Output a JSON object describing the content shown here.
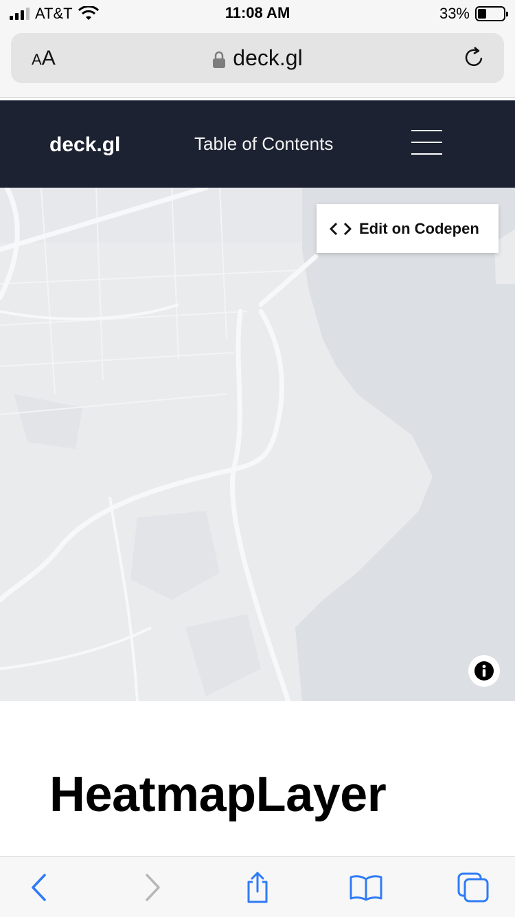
{
  "status_bar": {
    "carrier": "AT&T",
    "time": "11:08 AM",
    "battery": "33%",
    "battery_level": 0.33
  },
  "browser": {
    "text_size_label_small": "A",
    "text_size_label_large": "A",
    "url": "deck.gl"
  },
  "site_header": {
    "logo": "deck.gl",
    "toc_label": "Table of Contents"
  },
  "map": {
    "codepen_label": "Edit on Codepen"
  },
  "page": {
    "title": "HeatmapLayer"
  },
  "colors": {
    "header_bg": "#1c2231",
    "map_land": "#e9ebed",
    "map_water": "#dcdfe3",
    "accent_blue": "#2f7bf6"
  }
}
